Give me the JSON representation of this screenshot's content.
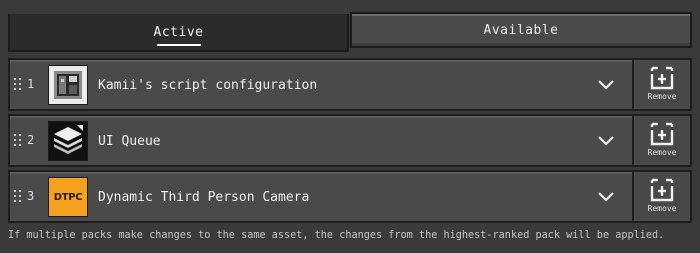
{
  "tabs": {
    "active_label": "Active",
    "available_label": "Available"
  },
  "packs": [
    {
      "rank": "1",
      "name": "Kamii's script configuration",
      "icon": "script-config-icon",
      "remove_label": "Remove"
    },
    {
      "rank": "2",
      "name": "UI Queue",
      "icon": "ui-queue-icon",
      "remove_label": "Remove"
    },
    {
      "rank": "3",
      "name": "Dynamic Third Person Camera",
      "icon": "dtpc-icon",
      "icon_text": "DTPC",
      "remove_label": "Remove"
    }
  ],
  "footer_text": "If multiple packs make changes to the same asset, the changes from the highest-ranked pack will be applied.",
  "colors": {
    "background": "#3a3a3b",
    "row": "#4a4a4b",
    "border": "#1e1e1e",
    "dtpc_orange": "#f6a21e"
  }
}
